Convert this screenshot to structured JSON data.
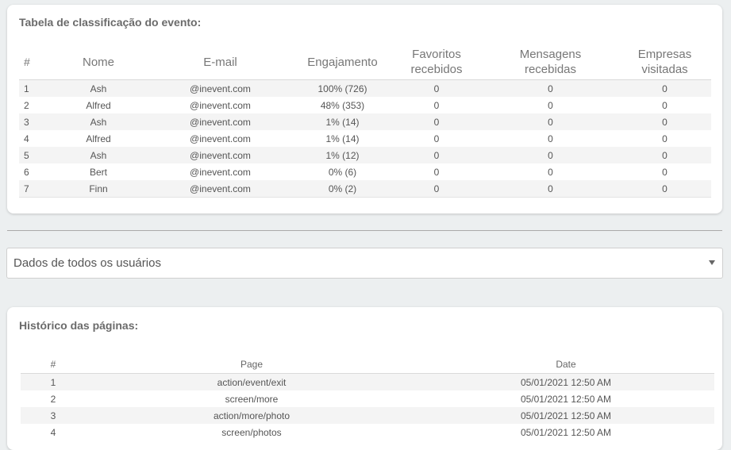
{
  "ranking": {
    "title": "Tabela de classificação do evento:",
    "headers": {
      "num": "#",
      "name": "Nome",
      "email": "E-mail",
      "engagement": "Engajamento",
      "favorites_line1": "Favoritos",
      "favorites_line2": "recebidos",
      "messages_line1": "Mensagens",
      "messages_line2": "recebidas",
      "companies_line1": "Empresas",
      "companies_line2": "visitadas"
    },
    "rows": [
      {
        "num": "1",
        "name": "Ash",
        "email": "@inevent.com",
        "engagement": "100% (726)",
        "favorites": "0",
        "messages": "0",
        "companies": "0"
      },
      {
        "num": "2",
        "name": "Alfred",
        "email": "@inevent.com",
        "engagement": "48% (353)",
        "favorites": "0",
        "messages": "0",
        "companies": "0"
      },
      {
        "num": "3",
        "name": "Ash",
        "email": "@inevent.com",
        "engagement": "1% (14)",
        "favorites": "0",
        "messages": "0",
        "companies": "0"
      },
      {
        "num": "4",
        "name": "Alfred",
        "email": "@inevent.com",
        "engagement": "1% (14)",
        "favorites": "0",
        "messages": "0",
        "companies": "0"
      },
      {
        "num": "5",
        "name": "Ash",
        "email": "@inevent.com",
        "engagement": "1% (12)",
        "favorites": "0",
        "messages": "0",
        "companies": "0"
      },
      {
        "num": "6",
        "name": "Bert",
        "email": "@inevent.com",
        "engagement": "0% (6)",
        "favorites": "0",
        "messages": "0",
        "companies": "0"
      },
      {
        "num": "7",
        "name": "Finn",
        "email": "@inevent.com",
        "engagement": "0% (2)",
        "favorites": "0",
        "messages": "0",
        "companies": "0"
      }
    ]
  },
  "user_select": {
    "selected": "Dados de todos os usuários",
    "icon": "caret-down-icon"
  },
  "history": {
    "title": "Histórico das páginas:",
    "headers": {
      "num": "#",
      "page": "Page",
      "date": "Date"
    },
    "rows": [
      {
        "num": "1",
        "page": "action/event/exit",
        "date": "05/01/2021 12:50 AM"
      },
      {
        "num": "2",
        "page": "screen/more",
        "date": "05/01/2021 12:50 AM"
      },
      {
        "num": "3",
        "page": "action/more/photo",
        "date": "05/01/2021 12:50 AM"
      },
      {
        "num": "4",
        "page": "screen/photos",
        "date": "05/01/2021 12:50 AM"
      }
    ]
  }
}
